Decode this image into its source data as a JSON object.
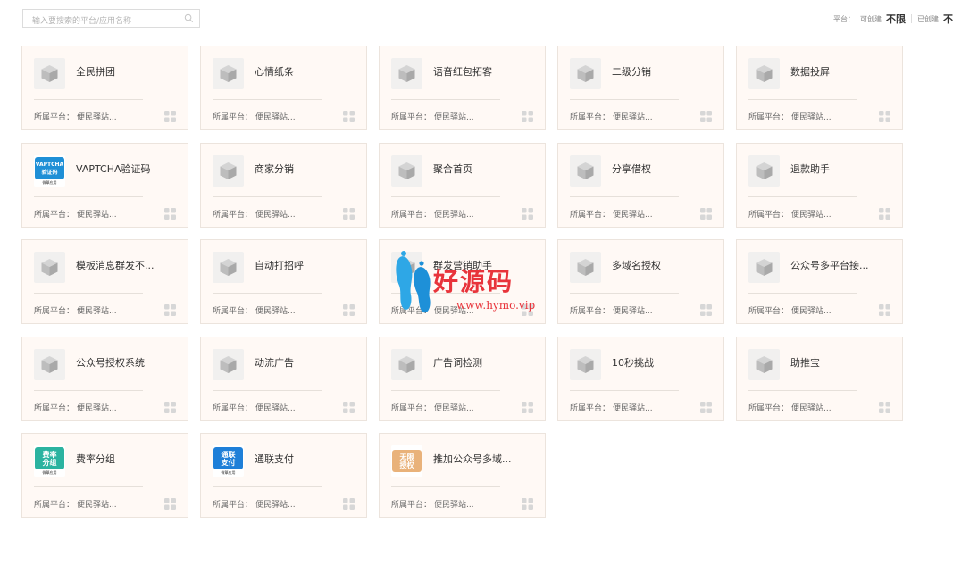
{
  "search": {
    "placeholder": "输入要搜索的平台/应用名称"
  },
  "quota": {
    "label": "平台：",
    "can_create_label": "可创建",
    "can_create_value": "不限",
    "created_label": "已创建",
    "created_value": "不"
  },
  "platform_label": "所属平台：",
  "cards": [
    {
      "title": "全民拼团",
      "platform": "便民驿站...",
      "icon": "cube-icon"
    },
    {
      "title": "心情纸条",
      "platform": "便民驿站...",
      "icon": "cube-icon"
    },
    {
      "title": "语音红包拓客",
      "platform": "便民驿站...",
      "icon": "cube-icon"
    },
    {
      "title": "二级分销",
      "platform": "便民驿站...",
      "icon": "cube-icon"
    },
    {
      "title": "数据投屏",
      "platform": "便民驿站...",
      "icon": "cube-icon"
    },
    {
      "title": "VAPTCHA验证码",
      "platform": "便民驿站...",
      "icon": "vaptcha-logo",
      "logo": {
        "line1": "VAPTCHA",
        "line2": "验证码",
        "sub": "微擎应用",
        "color": "#1f8fd6"
      }
    },
    {
      "title": "商家分销",
      "platform": "便民驿站...",
      "icon": "cube-icon"
    },
    {
      "title": "聚合首页",
      "platform": "便民驿站...",
      "icon": "cube-icon"
    },
    {
      "title": "分享借权",
      "platform": "便民驿站...",
      "icon": "cube-icon"
    },
    {
      "title": "退款助手",
      "platform": "便民驿站...",
      "icon": "cube-icon"
    },
    {
      "title": "模板消息群发不...",
      "platform": "便民驿站...",
      "icon": "cube-icon"
    },
    {
      "title": "自动打招呼",
      "platform": "便民驿站...",
      "icon": "cube-icon"
    },
    {
      "title": "群发营销助手",
      "platform": "便民驿站...",
      "icon": "cube-icon"
    },
    {
      "title": "多域名授权",
      "platform": "便民驿站...",
      "icon": "cube-icon"
    },
    {
      "title": "公众号多平台接...",
      "platform": "便民驿站...",
      "icon": "cube-icon"
    },
    {
      "title": "公众号授权系统",
      "platform": "便民驿站...",
      "icon": "cube-icon"
    },
    {
      "title": "动流广告",
      "platform": "便民驿站...",
      "icon": "cube-icon"
    },
    {
      "title": "广告词检测",
      "platform": "便民驿站...",
      "icon": "cube-icon"
    },
    {
      "title": "10秒挑战",
      "platform": "便民驿站...",
      "icon": "cube-icon"
    },
    {
      "title": "助推宝",
      "platform": "便民驿站...",
      "icon": "cube-icon"
    },
    {
      "title": "费率分组",
      "platform": "便民驿站...",
      "icon": "rate-group-logo",
      "logo": {
        "line1": "费率",
        "line2": "分组",
        "sub": "微擎应用",
        "color": "#2bb3a0"
      }
    },
    {
      "title": "通联支付",
      "platform": "便民驿站...",
      "icon": "allinpay-logo",
      "logo": {
        "line1": "通联",
        "line2": "支付",
        "sub": "微擎应用",
        "color": "#1e7fd8"
      }
    },
    {
      "title": "推加公众号多域...",
      "platform": "便民驿站...",
      "icon": "unlimited-auth-logo",
      "logo": {
        "line1": "无限",
        "line2": "授权",
        "sub": "",
        "color": "#e9b27a"
      }
    }
  ],
  "watermark": {
    "text": "好源码",
    "url": "www.hymo.vip",
    "color": "#e8343b"
  }
}
